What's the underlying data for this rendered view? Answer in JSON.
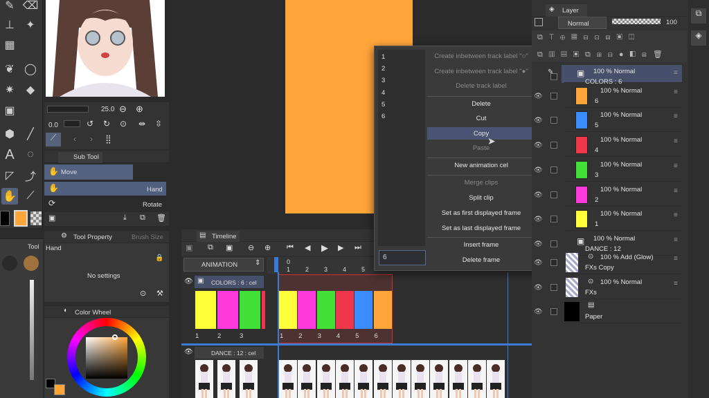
{
  "toolbar_icons": [
    "pen-icon",
    "eraser-icon",
    "fill-bucket-icon",
    "sparkle-icon",
    "grid-icon",
    "blend-icon",
    "lasso-icon",
    "magic-wand-icon",
    "fill-icon",
    "gradient-icon",
    "figure-icon",
    "line-icon",
    "text-icon",
    "balloon-icon",
    "ruler-icon",
    "correct-line-icon",
    "hand-icon",
    "eyedropper-icon"
  ],
  "brush_size": {
    "size": "25.0",
    "opacity": "0.0"
  },
  "sub_tool": {
    "title": "Sub Tool",
    "group": "Move",
    "items": [
      {
        "label": "Hand"
      },
      {
        "label": "Rotate"
      }
    ]
  },
  "tool_property": {
    "tab1": "Tool Property",
    "tab2": "Brush Size",
    "tool_name": "Hand",
    "message": "No settings"
  },
  "color_wheel": {
    "title": "Color Wheel",
    "main_color": "#ffa53a",
    "sub_color": "#000000"
  },
  "small_panel_label": "Tool",
  "context_menu": {
    "numbers": [
      "1",
      "2",
      "3",
      "4",
      "5",
      "6"
    ],
    "input_value": "6",
    "items": [
      {
        "label": "Create inbetween track label \"○\"",
        "enabled": false
      },
      {
        "label": "Create inbetween track label \"●\"",
        "enabled": false
      },
      {
        "label": "Delete track label",
        "enabled": false
      },
      {
        "label": "Delete",
        "enabled": true
      },
      {
        "label": "Cut",
        "enabled": true
      },
      {
        "label": "Copy",
        "enabled": true,
        "highlighted": true
      },
      {
        "label": "Paste",
        "enabled": false
      },
      {
        "label": "New animation cel",
        "enabled": true
      },
      {
        "label": "Merge clips",
        "enabled": false
      },
      {
        "label": "Split clip",
        "enabled": true
      },
      {
        "label": "Set as first displayed frame",
        "enabled": true
      },
      {
        "label": "Set as last displayed frame",
        "enabled": true
      },
      {
        "label": "Insert frame",
        "enabled": true
      },
      {
        "label": "Delete frame",
        "enabled": true
      }
    ]
  },
  "timeline": {
    "title": "Timeline",
    "animation_name": "ANIMATION",
    "ruler": [
      "0",
      "1",
      "2",
      "3",
      "4",
      "5"
    ],
    "tracks": [
      {
        "name": "COLORS : 6 : cel"
      },
      {
        "name": "DANCE : 12 : cel"
      }
    ],
    "left_cels": {
      "colors": [
        "#ffff3a",
        "#ff3adc",
        "#44e03a"
      ],
      "labels": [
        "1",
        "2",
        "3"
      ]
    },
    "cels": {
      "colors": [
        "#ffff3a",
        "#ff3adc",
        "#44e03a",
        "#f0364a",
        "#3a8cff",
        "#ffa53a"
      ],
      "labels": [
        "1",
        "2",
        "3",
        "4",
        "5",
        "6"
      ]
    }
  },
  "layer_panel": {
    "title": "Layer",
    "blend_mode": "Normal",
    "opacity": "100",
    "layers": [
      {
        "line1": "100 % Normal",
        "line2": "COLORS : 6",
        "type": "folder"
      },
      {
        "line1": "100 % Normal",
        "line2": "6",
        "color": "#ffa53a"
      },
      {
        "line1": "100 % Normal",
        "line2": "5",
        "color": "#3a8cff"
      },
      {
        "line1": "100 % Normal",
        "line2": "4",
        "color": "#f0364a"
      },
      {
        "line1": "100 % Normal",
        "line2": "3",
        "color": "#44e03a"
      },
      {
        "line1": "100 % Normal",
        "line2": "2",
        "color": "#ff3adc"
      },
      {
        "line1": "100 % Normal",
        "line2": "1",
        "color": "#ffff3a"
      },
      {
        "line1": "100 % Normal",
        "line2": "DANCE : 12",
        "type": "folder"
      },
      {
        "line1": "100 % Add (Glow)",
        "line2": "FXs Copy"
      },
      {
        "line1": "100 % Normal",
        "line2": "FXs"
      },
      {
        "line1": "",
        "line2": "Paper"
      }
    ]
  },
  "canvas": {
    "fill_color": "#ffa53a"
  }
}
